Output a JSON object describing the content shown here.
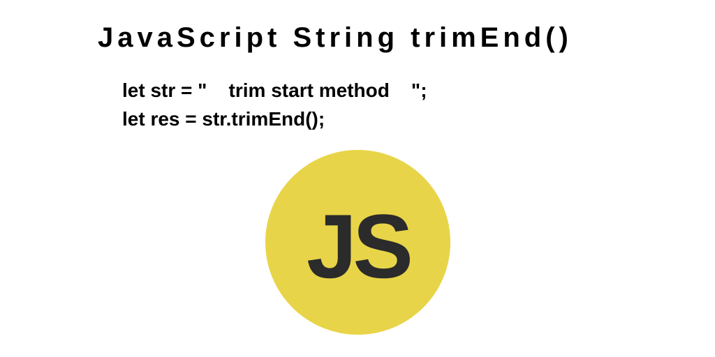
{
  "title": "JavaScript String trimEnd()",
  "code": {
    "line1": "let str = \"    trim start method    \";",
    "line2": "let res = str.trimEnd();"
  },
  "badge": {
    "label": "JS",
    "bg_color": "#e8d448",
    "text_color": "#2b2b2b"
  }
}
